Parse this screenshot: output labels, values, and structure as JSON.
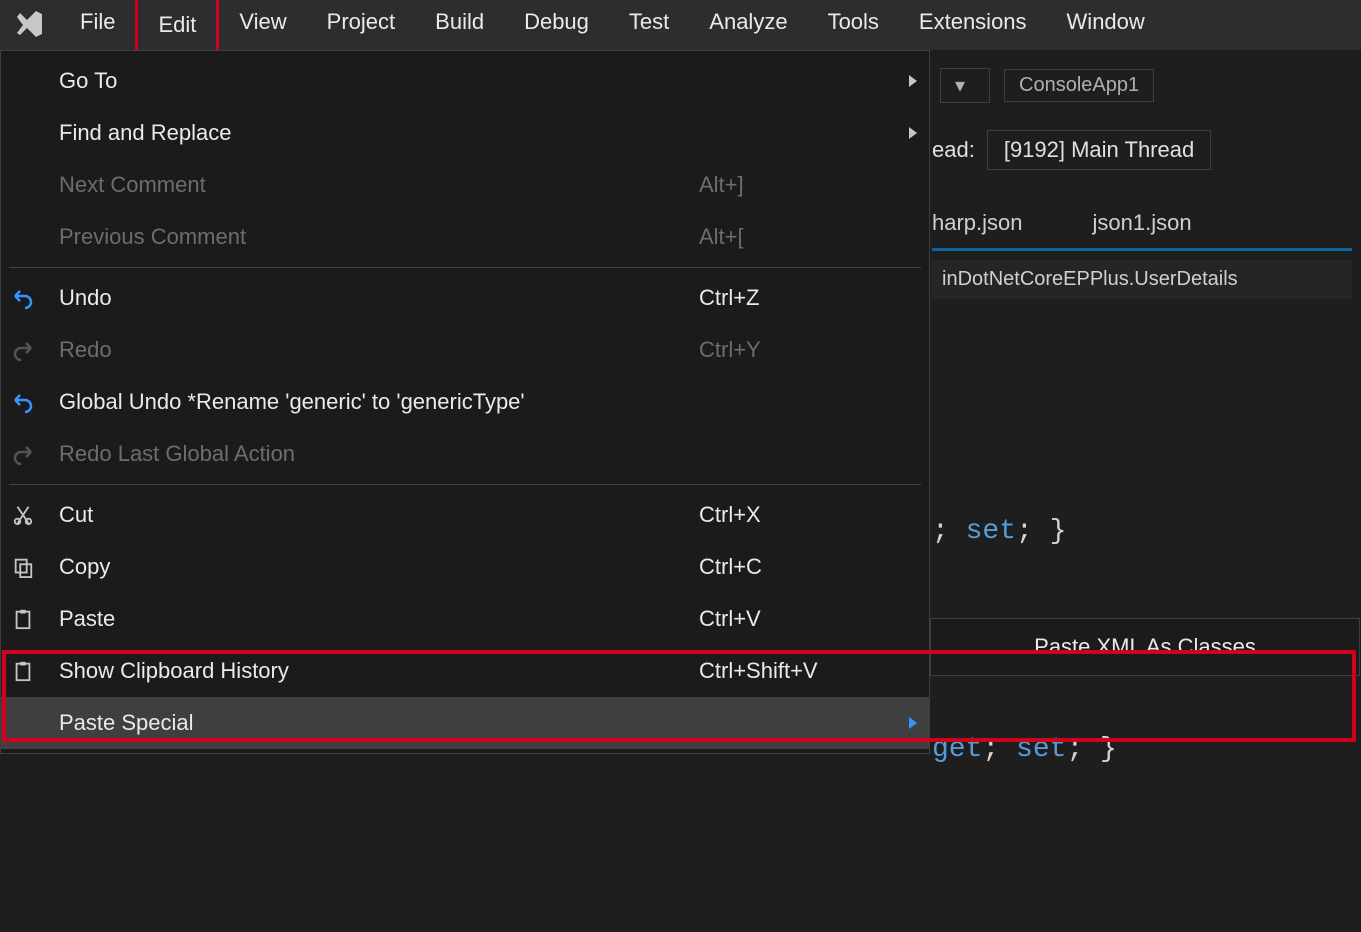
{
  "menubar": {
    "items": [
      "File",
      "Edit",
      "View",
      "Project",
      "Build",
      "Debug",
      "Test",
      "Analyze",
      "Tools",
      "Extensions",
      "Window"
    ],
    "highlighted": "Edit"
  },
  "dropdown": {
    "groups": [
      [
        {
          "label": "Go To",
          "shortcut": "",
          "submenu": true,
          "disabled": false
        },
        {
          "label": "Find and Replace",
          "shortcut": "",
          "submenu": true,
          "disabled": false
        },
        {
          "label": "Next Comment",
          "shortcut": "Alt+]",
          "submenu": false,
          "disabled": true
        },
        {
          "label": "Previous Comment",
          "shortcut": "Alt+[",
          "submenu": false,
          "disabled": true
        }
      ],
      [
        {
          "label": "Undo",
          "shortcut": "Ctrl+Z",
          "submenu": false,
          "icon": "undo"
        },
        {
          "label": "Redo",
          "shortcut": "Ctrl+Y",
          "submenu": false,
          "disabled": true,
          "icon": "redo"
        },
        {
          "label": "Global Undo *Rename 'generic' to 'genericType'",
          "shortcut": "",
          "submenu": false,
          "icon": "undo"
        },
        {
          "label": "Redo Last Global Action",
          "shortcut": "",
          "submenu": false,
          "disabled": true,
          "icon": "redo"
        }
      ],
      [
        {
          "label": "Cut",
          "shortcut": "Ctrl+X",
          "submenu": false,
          "icon": "cut"
        },
        {
          "label": "Copy",
          "shortcut": "Ctrl+C",
          "submenu": false,
          "icon": "copy"
        },
        {
          "label": "Paste",
          "shortcut": "Ctrl+V",
          "submenu": false,
          "icon": "paste"
        },
        {
          "label": "Show Clipboard History",
          "shortcut": "Ctrl+Shift+V",
          "submenu": false,
          "icon": "paste"
        },
        {
          "label": "Paste Special",
          "shortcut": "",
          "submenu": true,
          "hover": true
        }
      ]
    ]
  },
  "submenu": {
    "items": [
      "Paste XML As Classes"
    ]
  },
  "editor": {
    "combo1": "",
    "combo2": "ConsoleApp1",
    "threadLabel": "ead:",
    "threadValue": "[9192] Main Thread",
    "tabs": [
      "harp.json",
      "json1.json"
    ],
    "breadcrumb": "inDotNetCoreEPPlus.UserDetails",
    "codeLines": [
      {
        "pre": "; ",
        "kw1": "set",
        "mid": "; }"
      },
      {
        "pre": "",
        "kw0": "get",
        "mid0": "; ",
        "kw1": "set",
        "mid": "; }"
      }
    ]
  }
}
